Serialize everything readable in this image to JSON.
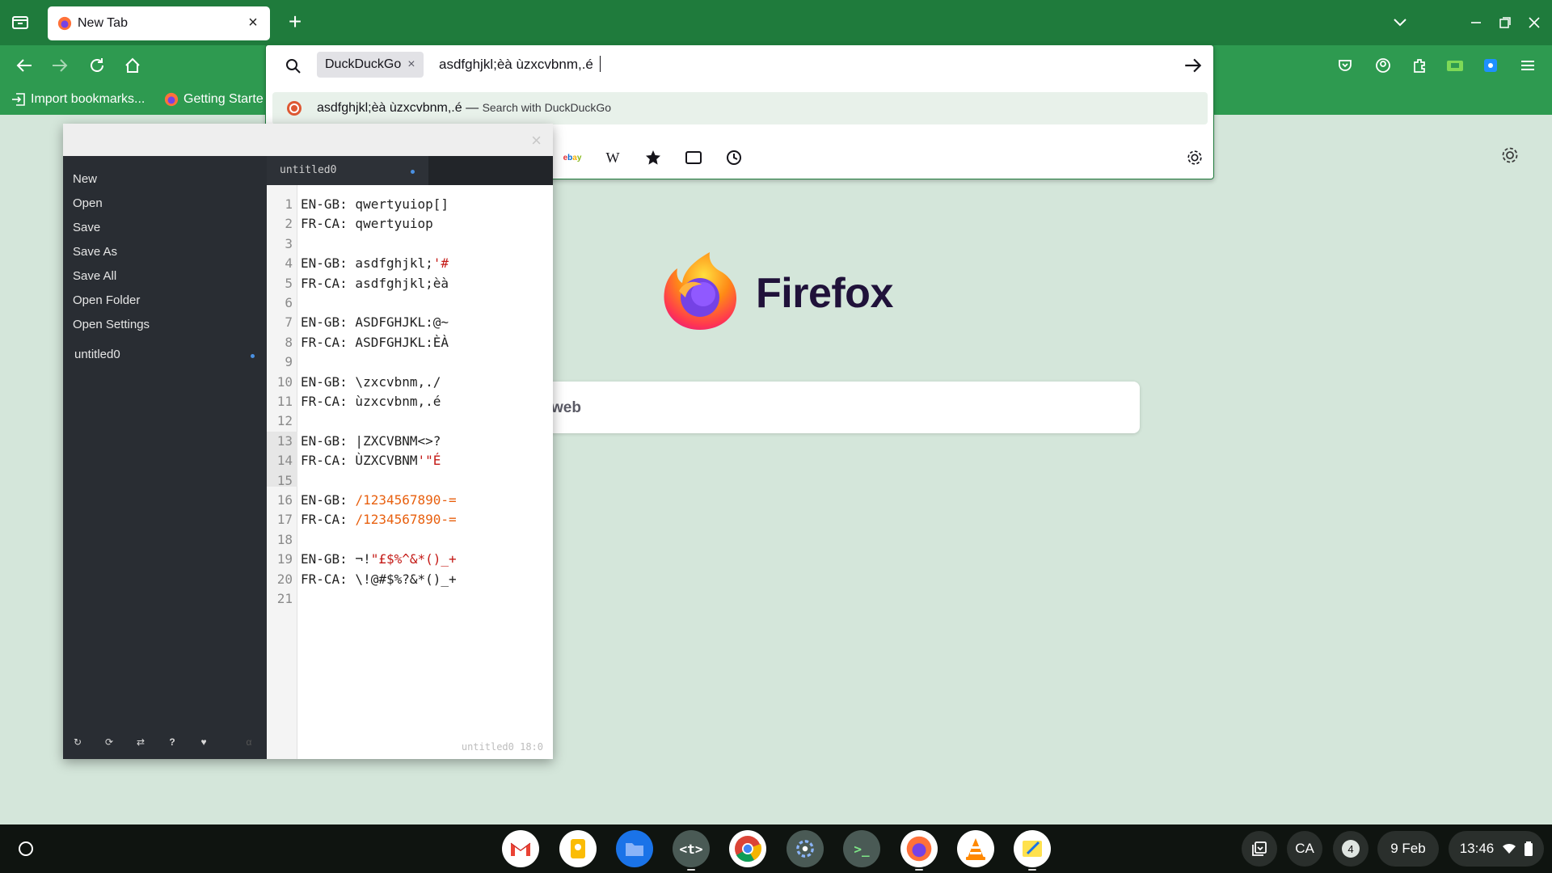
{
  "browser": {
    "tab": {
      "title": "New Tab"
    },
    "bookmarks": [
      {
        "label": "Import bookmarks..."
      },
      {
        "label": "Getting Starte"
      }
    ],
    "urlbar": {
      "engine": "DuckDuckGo",
      "query": "asdfghjkl;èà ùzxcvbnm,.é",
      "suggestion": {
        "text": "asdfghjkl;èà ùzxcvbnm,.é",
        "separator": "—",
        "action": "Search with DuckDuckGo"
      },
      "shortcuts": [
        "ebay-icon",
        "wikipedia-icon",
        "bookmarks-icon",
        "tabs-icon",
        "history-icon"
      ]
    },
    "newtab": {
      "brand": "Firefox",
      "search_fragment": "web"
    },
    "colors": {
      "tabbar": "#1f7b3c",
      "toolbar": "#2e9a50",
      "page": "#d4e6da"
    }
  },
  "editor": {
    "menu": [
      "New",
      "Open",
      "Save",
      "Save As",
      "Save All",
      "Open Folder",
      "Open Settings"
    ],
    "files": [
      "untitled0"
    ],
    "tab_label": "untitled0",
    "status": "untitled0 18:0",
    "lines": [
      {
        "n": "1",
        "parts": [
          {
            "t": "EN-GB: qwertyuiop[]"
          }
        ]
      },
      {
        "n": "2",
        "parts": [
          {
            "t": "FR-CA: qwertyuiop"
          }
        ]
      },
      {
        "n": "3",
        "parts": [
          {
            "t": ""
          }
        ]
      },
      {
        "n": "4",
        "parts": [
          {
            "t": "EN-GB: asdfghjkl;"
          },
          {
            "t": "'#",
            "c": "red"
          }
        ]
      },
      {
        "n": "5",
        "parts": [
          {
            "t": "FR-CA: asdfghjkl;èà"
          }
        ]
      },
      {
        "n": "6",
        "parts": [
          {
            "t": ""
          }
        ]
      },
      {
        "n": "7",
        "parts": [
          {
            "t": "EN-GB: ASDFGHJKL:@~"
          }
        ]
      },
      {
        "n": "8",
        "parts": [
          {
            "t": "FR-CA: ASDFGHJKL:ÈÀ"
          }
        ]
      },
      {
        "n": "9",
        "parts": [
          {
            "t": ""
          }
        ]
      },
      {
        "n": "10",
        "parts": [
          {
            "t": "EN-GB: \\zxcvbnm,./"
          }
        ]
      },
      {
        "n": "11",
        "parts": [
          {
            "t": "FR-CA: ùzxcvbnm,.é"
          }
        ]
      },
      {
        "n": "12",
        "parts": [
          {
            "t": ""
          }
        ]
      },
      {
        "n": "13",
        "parts": [
          {
            "t": "EN-GB: |ZXCVBNM<>?"
          }
        ]
      },
      {
        "n": "14",
        "parts": [
          {
            "t": "FR-CA: ÙZXCVBNM"
          },
          {
            "t": "'\"É",
            "c": "red"
          }
        ]
      },
      {
        "n": "15",
        "parts": [
          {
            "t": ""
          }
        ]
      },
      {
        "n": "16",
        "parts": [
          {
            "t": "EN-GB: "
          },
          {
            "t": "/1234567890-=",
            "c": "orange"
          }
        ]
      },
      {
        "n": "17",
        "parts": [
          {
            "t": "FR-CA: "
          },
          {
            "t": "/1234567890-=",
            "c": "orange"
          }
        ]
      },
      {
        "n": "18",
        "parts": [
          {
            "t": ""
          }
        ]
      },
      {
        "n": "19",
        "parts": [
          {
            "t": "EN-GB: ¬!"
          },
          {
            "t": "\"£$%^&*()_+",
            "c": "red"
          }
        ]
      },
      {
        "n": "20",
        "parts": [
          {
            "t": "FR-CA: \\!@#$%?&*()_+"
          }
        ]
      },
      {
        "n": "21",
        "parts": [
          {
            "t": ""
          }
        ]
      }
    ]
  },
  "shelf": {
    "apps": [
      "gmail-icon",
      "keep-icon",
      "files-icon",
      "text-editor-icon",
      "chrome-icon",
      "settings-icon",
      "terminal-icon",
      "firefox-icon",
      "vlc-icon",
      "notes-icon"
    ],
    "input_method": "CA",
    "notification_count": "4",
    "date": "9 Feb",
    "time": "13:46"
  }
}
